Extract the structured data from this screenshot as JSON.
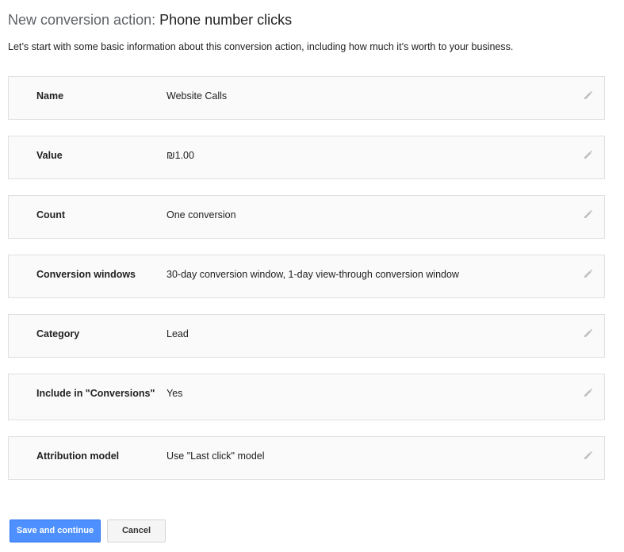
{
  "header": {
    "title_prefix": "New conversion action: ",
    "title_main": "Phone number clicks",
    "intro": "Let’s start with some basic information about this conversion action, including how much it’s worth to your business."
  },
  "rows": [
    {
      "label": "Name",
      "value": "Website Calls",
      "edit_icon": "pencil-icon"
    },
    {
      "label": "Value",
      "value": "₪1.00",
      "edit_icon": "pencil-icon"
    },
    {
      "label": "Count",
      "value": "One conversion",
      "edit_icon": "pencil-icon"
    },
    {
      "label": "Conversion windows",
      "value": "30-day conversion window, 1-day view-through conversion window",
      "edit_icon": "pencil-icon"
    },
    {
      "label": "Category",
      "value": "Lead",
      "edit_icon": "pencil-icon"
    },
    {
      "label": "Include in \"Conversions\"",
      "value": "Yes",
      "edit_icon": "pencil-icon"
    },
    {
      "label": "Attribution model",
      "value": "Use \"Last click\" model",
      "edit_icon": "pencil-icon"
    }
  ],
  "actions": {
    "save_label": "Save and continue",
    "cancel_label": "Cancel"
  },
  "colors": {
    "primary_button": "#4d90fe",
    "row_background": "#fafafa",
    "row_border": "#e0e0e0",
    "icon": "#bdbdbd"
  }
}
